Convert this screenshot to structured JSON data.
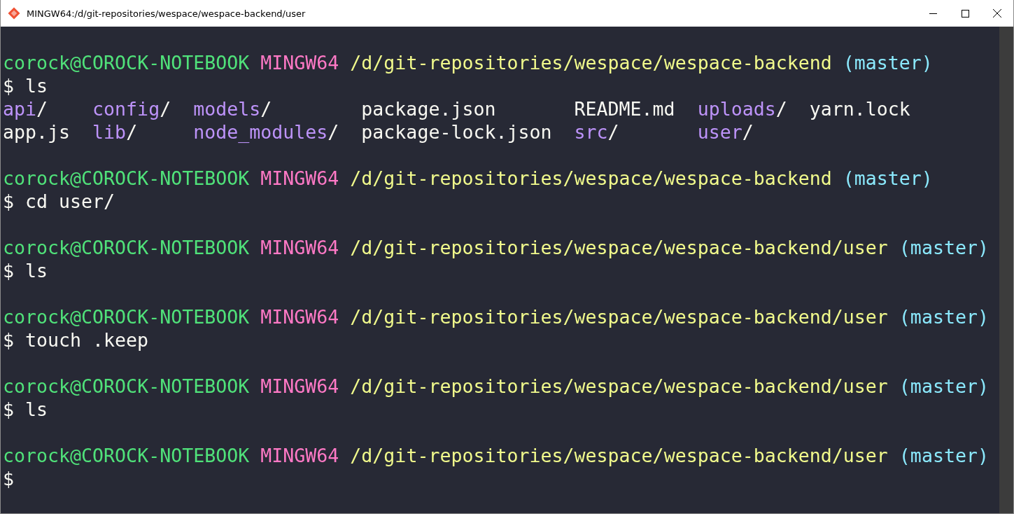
{
  "window": {
    "title": "MINGW64:/d/git-repositories/wespace/wespace-backend/user"
  },
  "sessions": [
    {
      "prompt": {
        "user": "corock@COROCK-NOTEBOOK",
        "system": "MINGW64",
        "path": "/d/git-repositories/wespace/wespace-backend",
        "branch": "(master)"
      },
      "command": {
        "sigil": "$",
        "text": "ls"
      },
      "output": [
        [
          {
            "name": "api",
            "suffix": "/",
            "kind": "dir"
          },
          {
            "name": "config",
            "suffix": "/",
            "kind": "dir"
          },
          {
            "name": "models",
            "suffix": "/",
            "kind": "dir"
          },
          {
            "name": "package.json",
            "kind": "file"
          },
          {
            "name": "README.md",
            "kind": "file"
          },
          {
            "name": "uploads",
            "suffix": "/",
            "kind": "dir"
          },
          {
            "name": "yarn.lock",
            "kind": "file"
          }
        ],
        [
          {
            "name": "app.js",
            "kind": "file"
          },
          {
            "name": "lib",
            "suffix": "/",
            "kind": "dir"
          },
          {
            "name": "node_modules",
            "suffix": "/",
            "kind": "dir"
          },
          {
            "name": "package-lock.json",
            "kind": "file"
          },
          {
            "name": "src",
            "suffix": "/",
            "kind": "dir"
          },
          {
            "name": "user",
            "suffix": "/",
            "kind": "dir"
          }
        ]
      ]
    },
    {
      "prompt": {
        "user": "corock@COROCK-NOTEBOOK",
        "system": "MINGW64",
        "path": "/d/git-repositories/wespace/wespace-backend",
        "branch": "(master)"
      },
      "command": {
        "sigil": "$",
        "text": "cd user/"
      }
    },
    {
      "prompt": {
        "user": "corock@COROCK-NOTEBOOK",
        "system": "MINGW64",
        "path": "/d/git-repositories/wespace/wespace-backend/user",
        "branch": "(master)"
      },
      "command": {
        "sigil": "$",
        "text": "ls"
      }
    },
    {
      "prompt": {
        "user": "corock@COROCK-NOTEBOOK",
        "system": "MINGW64",
        "path": "/d/git-repositories/wespace/wespace-backend/user",
        "branch": "(master)"
      },
      "command": {
        "sigil": "$",
        "text": "touch .keep"
      }
    },
    {
      "prompt": {
        "user": "corock@COROCK-NOTEBOOK",
        "system": "MINGW64",
        "path": "/d/git-repositories/wespace/wespace-backend/user",
        "branch": "(master)"
      },
      "command": {
        "sigil": "$",
        "text": "ls"
      }
    },
    {
      "prompt": {
        "user": "corock@COROCK-NOTEBOOK",
        "system": "MINGW64",
        "path": "/d/git-repositories/wespace/wespace-backend/user",
        "branch": "(master)"
      },
      "command": {
        "sigil": "$"
      }
    }
  ]
}
